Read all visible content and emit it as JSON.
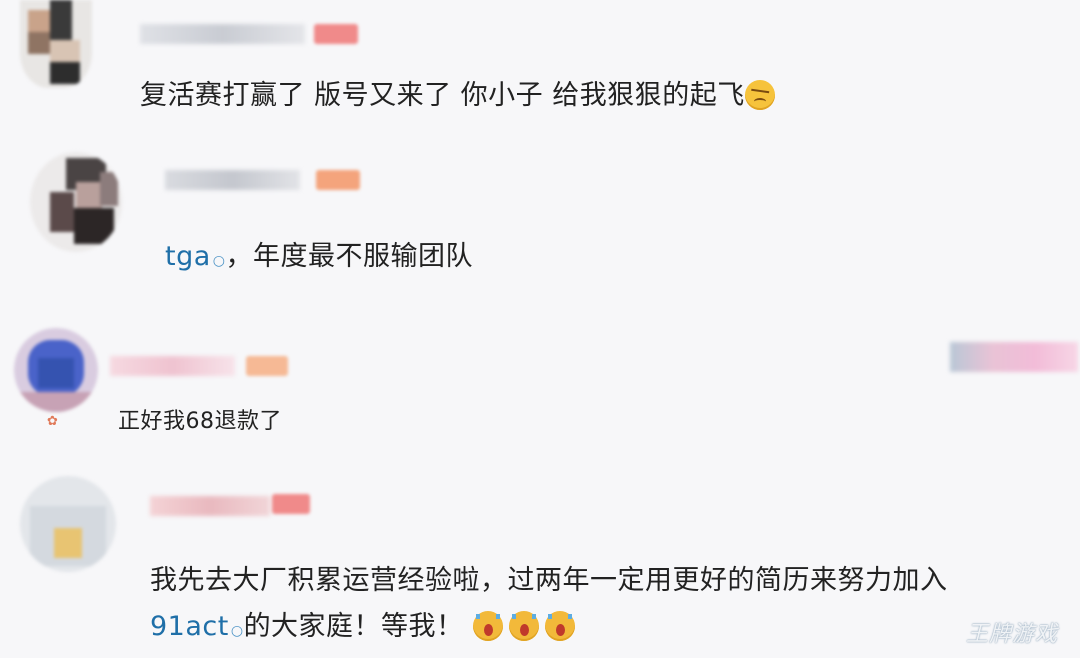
{
  "comments": [
    {
      "text": "复活赛打赢了 版号又来了 你小子 给我狠狠的起飞",
      "emoji": "angry-face-emoji"
    },
    {
      "topic": "tga",
      "text": "，年度最不服输团队"
    },
    {
      "text": "正好我68退款了"
    },
    {
      "line1": "我先去大厂积累运营经验啦，过两年一定用更好的简历来努力加入",
      "topic": "91act",
      "line2": "的大家庭！等我！",
      "emoji": "crying-face-emoji"
    }
  ],
  "topic_icon": "search-icon",
  "watermark": "王牌游戏",
  "colors": {
    "background": "#f7f7f9",
    "topic_link": "#1f6fa8",
    "tag_orange": "#f4a47c",
    "tag_pink": "#f08a8a"
  }
}
